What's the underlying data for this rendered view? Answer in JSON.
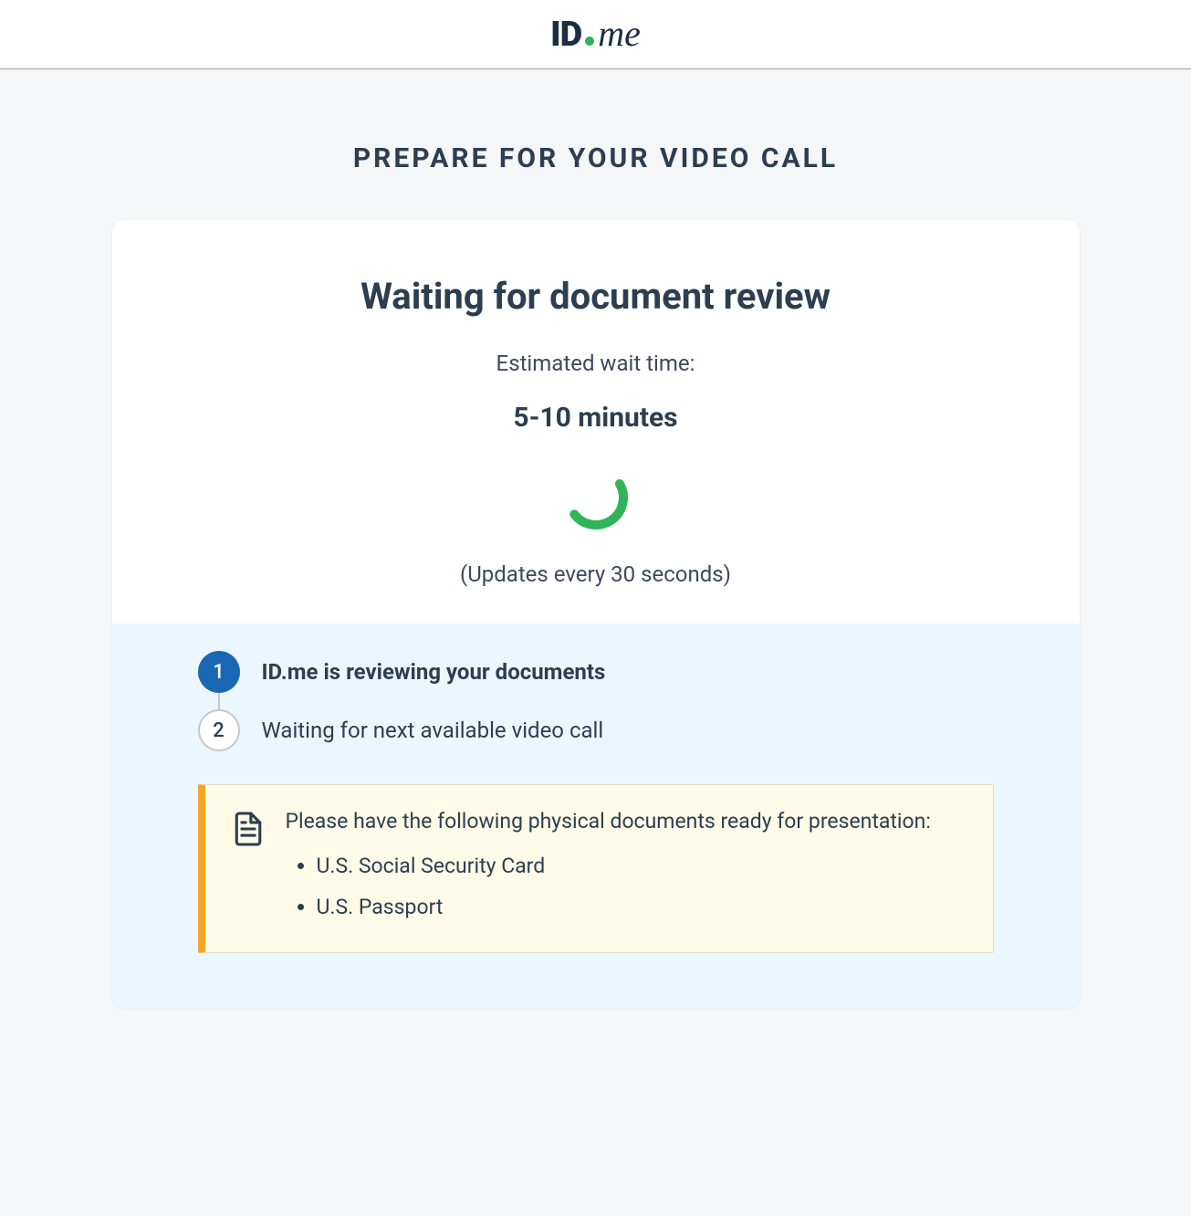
{
  "logo": {
    "id_text": "ID",
    "me_text": "me"
  },
  "page_title": "PREPARE FOR YOUR VIDEO CALL",
  "card": {
    "title": "Waiting for document review",
    "wait_label": "Estimated wait time:",
    "wait_time": "5-10 minutes",
    "update_note": "(Updates every 30 seconds)"
  },
  "steps": [
    {
      "num": "1",
      "label": "ID.me is reviewing your documents",
      "active": true
    },
    {
      "num": "2",
      "label": "Waiting for next available video call",
      "active": false
    }
  ],
  "notice": {
    "text": "Please have the following physical documents ready for presentation:",
    "items": [
      "U.S. Social Security Card",
      "U.S. Passport"
    ]
  }
}
